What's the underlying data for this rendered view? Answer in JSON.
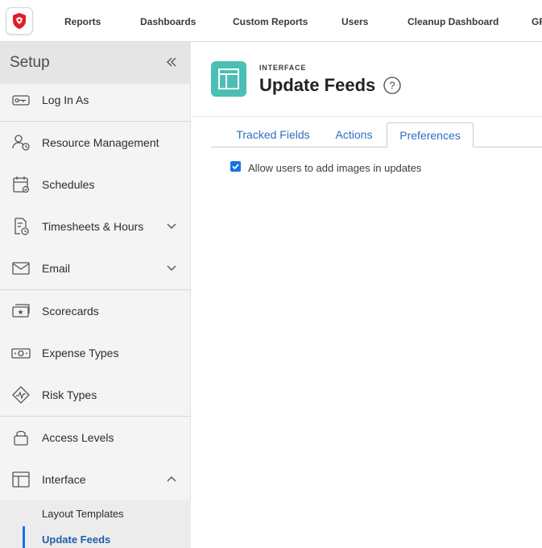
{
  "topnav": {
    "items": [
      "Reports",
      "Dashboards",
      "Custom Reports",
      "Users",
      "Cleanup Dashboard",
      "GR"
    ]
  },
  "sidebar": {
    "title": "Setup",
    "items": [
      {
        "label": "Log In As",
        "icon": "key-icon"
      },
      {
        "label": "Resource Management",
        "icon": "people-icon"
      },
      {
        "label": "Schedules",
        "icon": "calendar-icon"
      },
      {
        "label": "Timesheets & Hours",
        "icon": "timesheet-icon",
        "expandable": true
      },
      {
        "label": "Email",
        "icon": "envelope-icon",
        "expandable": true
      },
      {
        "label": "Scorecards",
        "icon": "scorecard-icon"
      },
      {
        "label": "Expense Types",
        "icon": "money-icon"
      },
      {
        "label": "Risk Types",
        "icon": "risk-icon"
      },
      {
        "label": "Access Levels",
        "icon": "lock-icon"
      },
      {
        "label": "Interface",
        "icon": "layout-icon",
        "expanded": true
      }
    ],
    "subitems": [
      {
        "label": "Layout Templates"
      },
      {
        "label": "Update Feeds",
        "active": true
      }
    ]
  },
  "page": {
    "kicker": "INTERFACE",
    "title": "Update Feeds",
    "tabs": [
      {
        "label": "Tracked Fields"
      },
      {
        "label": "Actions"
      },
      {
        "label": "Preferences",
        "active": true
      }
    ],
    "preferences": [
      {
        "label": "Allow users to add images in updates",
        "checked": true
      }
    ]
  },
  "colors": {
    "accent": "#1473e6",
    "brand_teal": "#4bbfb4",
    "logo_red": "#e11d26",
    "link_blue": "#2c6fbd"
  }
}
